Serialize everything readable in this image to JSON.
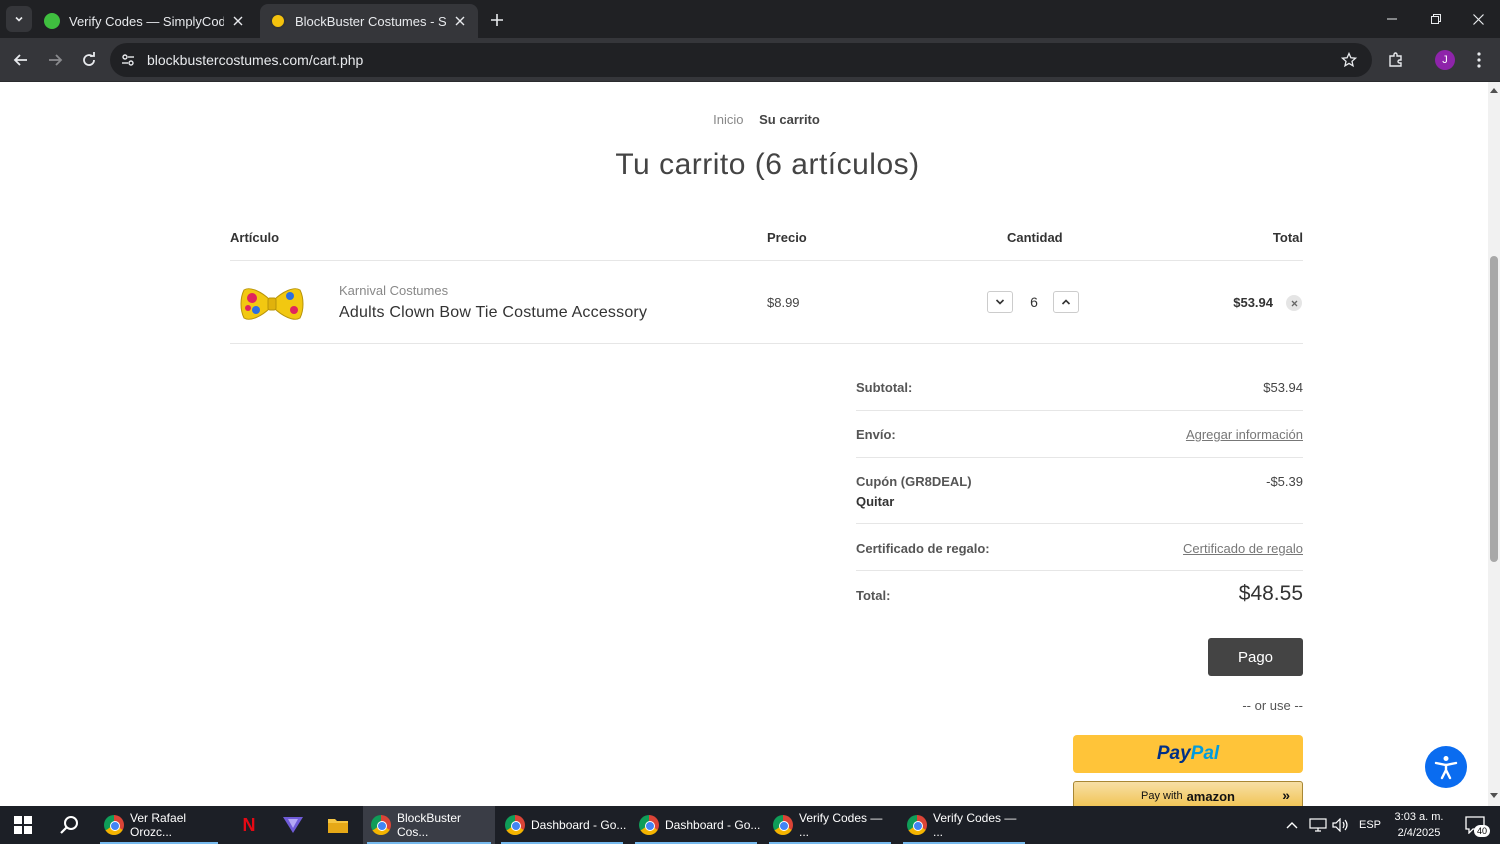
{
  "browser": {
    "tabs": [
      {
        "title": "Verify Codes — SimplyCodes",
        "active": false
      },
      {
        "title": "BlockBuster Costumes - Shopping Cart",
        "active": true
      }
    ],
    "url": "blockbustercostumes.com/cart.php",
    "profile_initial": "J"
  },
  "breadcrumb": {
    "home": "Inicio",
    "current": "Su carrito"
  },
  "page_title": "Tu carrito (6 artículos)",
  "table_headers": {
    "item": "Artículo",
    "price": "Precio",
    "quantity": "Cantidad",
    "total": "Total"
  },
  "cart_items": [
    {
      "brand": "Karnival Costumes",
      "name": "Adults Clown Bow Tie Costume Accessory",
      "price": "$8.99",
      "quantity": "6",
      "total": "$53.94"
    }
  ],
  "summary": {
    "subtotal_label": "Subtotal:",
    "subtotal_value": "$53.94",
    "shipping_label": "Envío:",
    "shipping_link": "Agregar información",
    "coupon_label": "Cupón (GR8DEAL)",
    "coupon_remove": "Quitar",
    "coupon_value": "-$5.39",
    "gift_label": "Certificado de regalo:",
    "gift_link": "Certificado de regalo",
    "total_label": "Total:",
    "total_value": "$48.55"
  },
  "checkout": {
    "button": "Pago",
    "or_use": "-- or use --",
    "paypal_pay": "Pay",
    "paypal_pal": "Pal",
    "amazon_prefix": "Pay with",
    "amazon_brand": "amazon"
  },
  "taskbar": {
    "apps": [
      {
        "label": "Ver Rafael Orozc...",
        "active": false
      },
      {
        "label": "BlockBuster Cos...",
        "active": true
      },
      {
        "label": "Dashboard - Go...",
        "active": false
      },
      {
        "label": "Dashboard - Go...",
        "active": false
      },
      {
        "label": "Verify Codes — ...",
        "active": false
      },
      {
        "label": "Verify Codes — ...",
        "active": false
      }
    ],
    "language": "ESP",
    "time": "3:03 a. m.",
    "date": "2/4/2025",
    "notifications": "40"
  },
  "colors": {
    "chrome_dark": "#202124",
    "chrome_toolbar": "#35363a",
    "checkout_button": "#444444",
    "paypal_yellow": "#ffc439",
    "accessibility_blue": "#0a6cf0"
  }
}
